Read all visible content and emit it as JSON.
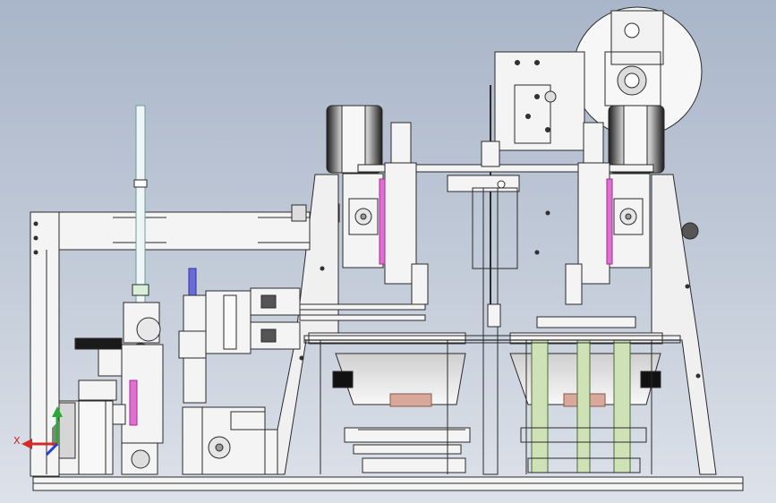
{
  "view": {
    "background_top": "#a9b5c9",
    "background_bottom": "#dde2ea",
    "line_color": "#2a2a2a",
    "part_fill": "#f4f4f4"
  },
  "triad": {
    "x_label": "X",
    "x_color": "#d42a2a",
    "y_color": "#2a3cd4",
    "z_color": "#2aa838"
  },
  "accents": {
    "green_parts": "#cfe2b6",
    "pink_slots": "#e070d0",
    "copper_blocks": "#d8a89a",
    "blue_cap": "#6a6ad8"
  },
  "assembly": {
    "rollers": [
      "dark-roller-left",
      "dark-roller-right"
    ],
    "reel": "reel-disk",
    "motors": [
      "motor-left",
      "motor-right",
      "motor-bottom-left"
    ]
  }
}
